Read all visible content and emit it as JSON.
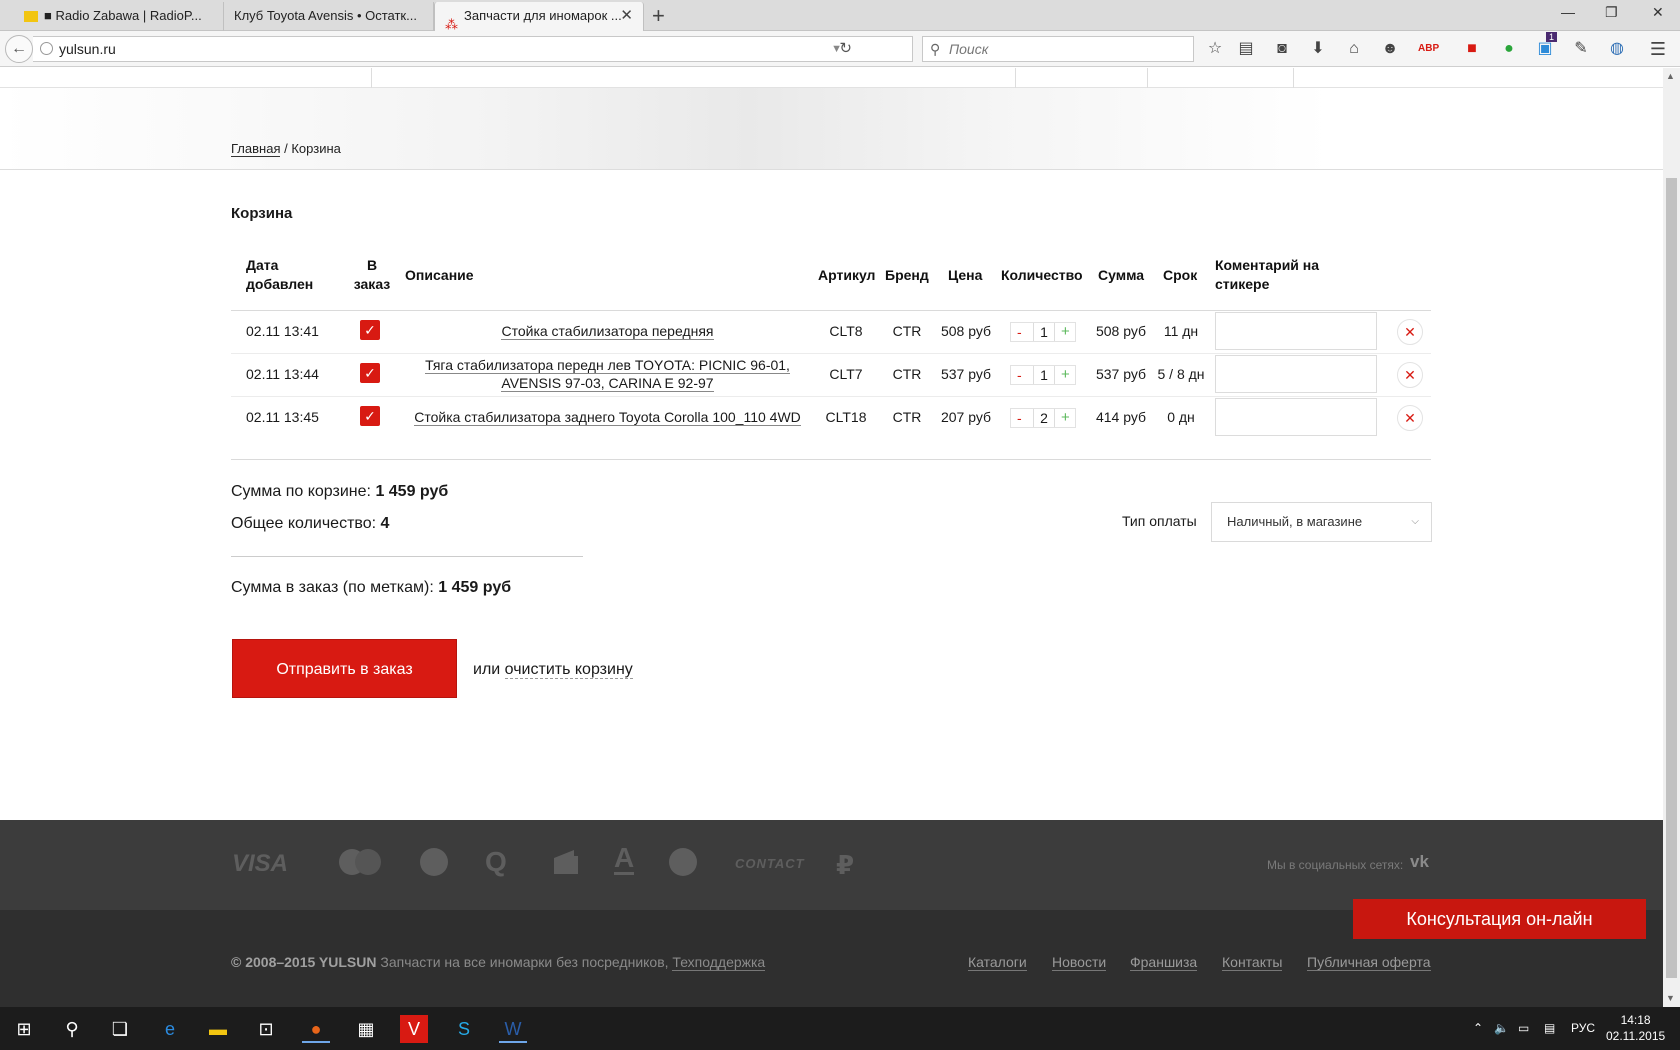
{
  "browser": {
    "tabs": [
      {
        "label": "■ Radio Zabawa | RadioP..."
      },
      {
        "label": "Клуб Toyota Avensis • Остатк..."
      },
      {
        "label": "Запчасти для иномарок ..."
      }
    ],
    "url": "yulsun.ru",
    "search_placeholder": "Поиск",
    "notification_count": "1"
  },
  "breadcrumb": {
    "home": "Главная",
    "separator": "/",
    "current": "Корзина"
  },
  "cart": {
    "title": "Корзина",
    "columns": {
      "date_line1": "Дата",
      "date_line2": "добавлен",
      "order_line1": "В",
      "order_line2": "заказ",
      "description": "Описание",
      "article": "Артикул",
      "brand": "Бренд",
      "price": "Цена",
      "quantity": "Количество",
      "sum": "Сумма",
      "term": "Срок",
      "comment_line1": "Коментарий на",
      "comment_line2": "стикере"
    },
    "rows": [
      {
        "date": "02.11 13:41",
        "desc_line1": "Стойка стабилизатора передняя",
        "desc_line2": "",
        "article": "CLT8",
        "brand": "CTR",
        "price": "508 руб",
        "qty": "1",
        "sum": "508 руб",
        "term": "11 дн"
      },
      {
        "date": "02.11 13:44",
        "desc_line1": "Тяга стабилизатора передн лев TOYOTA: PICNIC 96-01,",
        "desc_line2": "AVENSIS 97-03, CARINA E 92-97",
        "article": "CLT7",
        "brand": "CTR",
        "price": "537 руб",
        "qty": "1",
        "sum": "537 руб",
        "term": "5 / 8 дн"
      },
      {
        "date": "02.11 13:45",
        "desc_line1": "Стойка стабилизатора заднего Toyota Corolla 100_110 4WD",
        "desc_line2": "",
        "article": "CLT18",
        "brand": "CTR",
        "price": "207 руб",
        "qty": "2",
        "sum": "414 руб",
        "term": "0 дн"
      }
    ],
    "qty_minus": "-",
    "qty_plus": "+",
    "delete_glyph": "✕",
    "check_glyph": "✓",
    "total_label": "Сумма по корзине:",
    "total_value": "1 459 руб",
    "count_label": "Общее количество:",
    "count_value": "4",
    "order_sum_label": "Сумма в заказ (по меткам):",
    "order_sum_value": "1 459 руб",
    "payment_label": "Тип оплаты",
    "payment_value": "Наличный, в магазине",
    "submit_label": "Отправить в заказ",
    "or_text": "или",
    "clear_label": "очистить корзину"
  },
  "footer": {
    "payment_icons": [
      "VISA",
      "MC",
      "WM",
      "Q",
      "YM",
      "A",
      "SB",
      "CONTACT",
      "₽"
    ],
    "social_label": "Мы в социальных сетях:",
    "vk": "vk",
    "copyright_years": "© 2008–2015 YULSUN",
    "copyright_text": "Запчасти на все иномарки без посредников,",
    "support": "Техподдержка",
    "links": [
      "Каталоги",
      "Новости",
      "Франшиза",
      "Контакты",
      "Публичная оферта"
    ],
    "consult": "Консультация он-лайн"
  },
  "taskbar": {
    "lang": "РУС",
    "time": "14:18",
    "date": "02.11.2015"
  },
  "colors": {
    "accent": "#d81a12",
    "footer_dark": "#3c3c3c",
    "footer_darker": "#2f2f2f"
  }
}
